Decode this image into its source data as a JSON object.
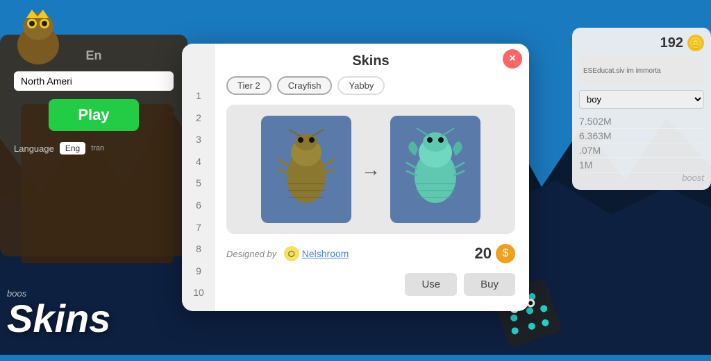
{
  "background": {
    "color": "#1a7abf"
  },
  "modal": {
    "title": "Skins",
    "close_label": "×",
    "tabs": [
      {
        "label": "Tier 2",
        "active": true
      },
      {
        "label": "Crayfish",
        "active": false
      },
      {
        "label": "Yabby",
        "active": false
      }
    ],
    "row_numbers": [
      "1",
      "2",
      "3",
      "4",
      "5",
      "6",
      "7",
      "8",
      "9",
      "10"
    ],
    "skin_normal_alt": "Normal crayfish skin",
    "skin_alt_alt": "Teal crayfish skin",
    "arrow": "→",
    "designed_by_label": "Designed by",
    "designer_avatar_symbol": "⬡",
    "designer_name": "Nelshroom",
    "price": "20",
    "price_coin": "$",
    "btn_use": "Use",
    "btn_buy": "Buy"
  },
  "left_panel": {
    "title": "En",
    "region_label": "North Ameri",
    "play_label": "Play",
    "language_label": "Language",
    "lang_code": "Eng",
    "lang_sub": "tran"
  },
  "right_panel": {
    "coins": "192",
    "coin_symbol": "🪙",
    "ad_text": "ESEducat.siv\nim immorta",
    "server_options": [
      "boy"
    ],
    "scores": [
      "7.502M",
      "6.363M",
      ".07M",
      "1M"
    ],
    "boost_label": "boost"
  },
  "watermark": {
    "skins_label": "Skins",
    "boost_label": "boos"
  },
  "boost_right": {
    "label": "boost"
  }
}
